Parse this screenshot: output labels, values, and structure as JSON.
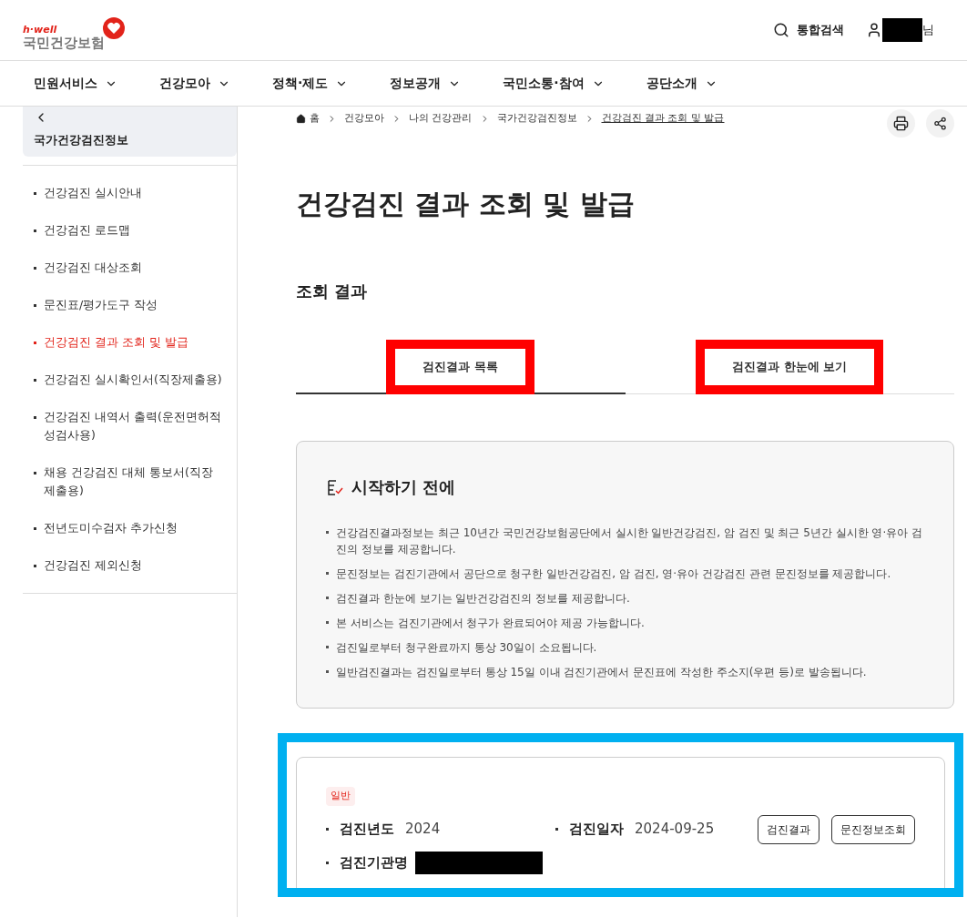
{
  "header": {
    "logo": {
      "tagline": "h·well",
      "name": "국민건강보험"
    },
    "search_label": "통합검색",
    "user": {
      "redacted": true,
      "suffix": "님"
    }
  },
  "nav": {
    "items": [
      {
        "label": "민원서비스"
      },
      {
        "label": "건강모아"
      },
      {
        "label": "정책·제도"
      },
      {
        "label": "정보공개"
      },
      {
        "label": "국민소통·참여"
      },
      {
        "label": "공단소개"
      }
    ]
  },
  "sidebar": {
    "title": "국가건강검진정보",
    "items": [
      {
        "label": "건강검진 실시안내",
        "selected": false
      },
      {
        "label": "건강검진 로드맵",
        "selected": false
      },
      {
        "label": "건강검진 대상조회",
        "selected": false
      },
      {
        "label": "문진표/평가도구 작성",
        "selected": false
      },
      {
        "label": "건강검진 결과 조회 및 발급",
        "selected": true
      },
      {
        "label": "건강검진 실시확인서(직장제출용)",
        "selected": false
      },
      {
        "label": "건강검진 내역서 출력(운전면허적성검사용)",
        "selected": false
      },
      {
        "label": "채용 건강검진 대체 통보서(직장제출용)",
        "selected": false
      },
      {
        "label": "전년도미수검자 추가신청",
        "selected": false
      },
      {
        "label": "건강검진 제외신청",
        "selected": false
      }
    ]
  },
  "breadcrumb": [
    "홈",
    "건강모아",
    "나의 건강관리",
    "국가건강검진정보",
    "건강검진 결과 조회 및 발급"
  ],
  "page_title": "건강검진 결과 조회 및 발급",
  "section_title": "조회 결과",
  "tabs": [
    {
      "label": "검진결과 목록",
      "selected": true,
      "highlighted": true
    },
    {
      "label": "검진결과 한눈에 보기",
      "selected": false,
      "highlighted": true
    }
  ],
  "notice": {
    "title": "시작하기 전에",
    "items": [
      "건강검진결과정보는 최근 10년간 국민건강보험공단에서 실시한 일반건강검진, 암 검진 및 최근 5년간 실시한 영·유아 검진의 정보를 제공합니다.",
      "문진정보는 검진기관에서 공단으로 청구한 일반건강검진, 암 검진, 영·유아 건강검진 관련 문진정보를 제공합니다.",
      "검진결과 한눈에 보기는 일반건강검진의 정보를 제공합니다.",
      "본 서비스는 검진기관에서 청구가 완료되어야 제공 가능합니다.",
      "검진일로부터 청구완료까지 통상 30일이 소요됩니다.",
      "일반검진결과는 검진일로부터 통상 15일 이내 검진기관에서 문진표에 작성한 주소지(우편 등)로 발송됩니다."
    ]
  },
  "result_card": {
    "highlighted": true,
    "tag": "일반",
    "fields": [
      {
        "label": "검진년도",
        "value": "2024"
      },
      {
        "label": "검진일자",
        "value": "2024-09-25"
      },
      {
        "label": "검진기관명",
        "redacted": true
      }
    ],
    "buttons": [
      "검진결과",
      "문진정보조회"
    ]
  }
}
